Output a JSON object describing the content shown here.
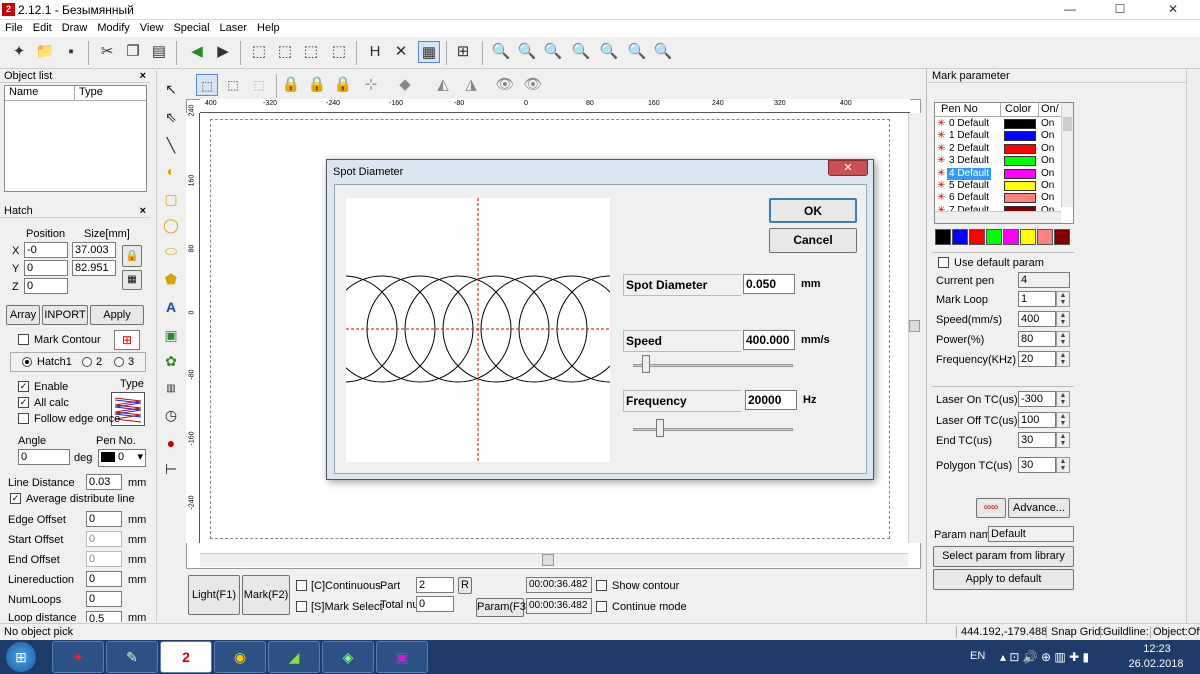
{
  "window": {
    "title": "2.12.1 - Безымянный",
    "app_icon": "ezcad-icon",
    "min": "—",
    "max": "☐",
    "close": "✕"
  },
  "menu": [
    "File",
    "Edit",
    "Draw",
    "Modify",
    "View",
    "Special",
    "Laser",
    "Help"
  ],
  "object_list": {
    "title": "Object list",
    "col_name": "Name",
    "col_type": "Type"
  },
  "hatch": {
    "title": "Hatch",
    "position_label": "Position",
    "size_label": "Size[mm]",
    "x_label": "X",
    "y_label": "Y",
    "z_label": "Z",
    "x_pos": "-0",
    "y_pos": "0",
    "z_pos": "0",
    "x_size": "37.003",
    "y_size": "82.951",
    "array": "Array",
    "inport": "INPORT",
    "apply": "Apply",
    "mark_contour": "Mark Contour",
    "hatch1": "Hatch1",
    "opt2": "2",
    "opt3": "3",
    "type_label": "Type",
    "enable": "Enable",
    "all_calc": "All calc",
    "follow_edge": "Follow edge once",
    "angle_label": "Angle",
    "angle_value": "0",
    "deg": "deg",
    "pen_no_label": "Pen No.",
    "pen_no_value": "0",
    "line_distance_label": "Line Distance",
    "line_distance_value": "0.03",
    "avg_distribute": "Average distribute line",
    "edge_offset_label": "Edge Offset",
    "edge_offset_value": "0",
    "start_offset_label": "Start Offset",
    "start_offset_value": "0",
    "end_offset_label": "End Offset",
    "end_offset_value": "0",
    "linereduction_label": "Linereduction",
    "linereduction_value": "0",
    "numloops_label": "NumLoops",
    "numloops_value": "0",
    "loop_distance_label": "Loop distance",
    "loop_distance_value": "0.5",
    "mm": "mm"
  },
  "ruler": {
    "top": [
      "400",
      "-320",
      "-240",
      "-160",
      "-80",
      "0",
      "80",
      "160",
      "240",
      "320",
      "400"
    ],
    "left": [
      "240",
      "160",
      "80",
      "0",
      "-80",
      "-160",
      "-240"
    ]
  },
  "bottom_controls": {
    "light": "Light(F1)",
    "mark": "Mark(F2)",
    "continuous": "[C]Continuous",
    "mark_select": "[S]Mark Select",
    "part_label": "Part",
    "part_value": "2",
    "r_button": "R",
    "total_label": "Total nu",
    "total_value": "0",
    "param": "Param(F3)",
    "time1": "00:00:36.482",
    "time2": "00:00:36.482",
    "show_contour": "Show contour",
    "continue_mode": "Continue mode"
  },
  "mark_parameter": {
    "title": "Mark parameter",
    "col_pen": "Pen No",
    "col_color": "Color",
    "col_on": "On/",
    "pens": [
      {
        "name": "0 Default",
        "color": "#000000",
        "on": "On"
      },
      {
        "name": "1 Default",
        "color": "#0000ff",
        "on": "On"
      },
      {
        "name": "2 Default",
        "color": "#ff0000",
        "on": "On"
      },
      {
        "name": "3 Default",
        "color": "#00ff00",
        "on": "On"
      },
      {
        "name": "4 Default",
        "color": "#ff00ff",
        "on": "On"
      },
      {
        "name": "5 Default",
        "color": "#ffff00",
        "on": "On"
      },
      {
        "name": "6 Default",
        "color": "#ff8080",
        "on": "On"
      },
      {
        "name": "7 Default",
        "color": "#800000",
        "on": "On"
      }
    ],
    "selected_pen": 4,
    "swatches": [
      "#000000",
      "#0000ff",
      "#ff0000",
      "#00ff00",
      "#ff00ff",
      "#ffff00",
      "#ff8080",
      "#800000"
    ],
    "use_default": "Use default param",
    "current_pen_label": "Current pen",
    "current_pen_value": "4",
    "mark_loop_label": "Mark Loop",
    "mark_loop_value": "1",
    "speed_label": "Speed(mm/s)",
    "speed_value": "400",
    "power_label": "Power(%)",
    "power_value": "80",
    "frequency_label": "Frequency(KHz)",
    "frequency_value": "20",
    "laser_on_label": "Laser On TC(us)",
    "laser_on_value": "-300",
    "laser_off_label": "Laser Off TC(us)",
    "laser_off_value": "100",
    "end_tc_label": "End TC(us)",
    "end_tc_value": "30",
    "polygon_tc_label": "Polygon TC(us)",
    "polygon_tc_value": "30",
    "advance": "Advance...",
    "param_name_label": "Param name",
    "param_name_value": "Default",
    "select_library": "Select param from library",
    "apply_default": "Apply to default"
  },
  "dialog": {
    "title": "Spot Diameter",
    "ok": "OK",
    "cancel": "Cancel",
    "spot_label": "Spot Diameter",
    "spot_value": "0.050",
    "spot_unit": "mm",
    "speed_label": "Speed",
    "speed_value": "400.000",
    "speed_unit": "mm/s",
    "freq_label": "Frequency",
    "freq_value": "20000",
    "freq_unit": "Hz",
    "speed_slider": 0.06,
    "freq_slider": 0.15
  },
  "status": {
    "left": "No object pick",
    "coords": "444.192,-179.488",
    "snap": "Snap Grid:",
    "guide": "Guildline:(",
    "object": "Object:Off"
  },
  "taskbar": {
    "lang": "EN",
    "time": "12:23",
    "date": "26.02.2018"
  }
}
